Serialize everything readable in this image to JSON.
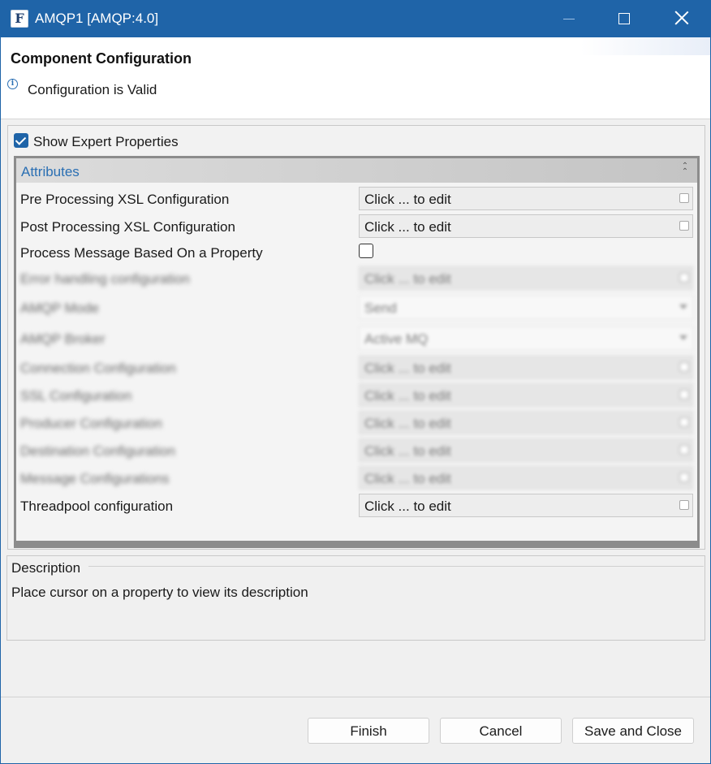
{
  "window": {
    "title": "AMQP1 [AMQP:4.0]",
    "icon_letter": "F",
    "controls": [
      "minimize-icon",
      "maximize-icon",
      "close-icon"
    ]
  },
  "header": {
    "title": "Component Configuration",
    "status_message": "Configuration is Valid",
    "status_icon": "info-icon"
  },
  "options": {
    "show_expert_label": "Show Expert Properties",
    "show_expert_checked": true
  },
  "attributes": {
    "section_title": "Attributes",
    "properties": [
      {
        "label": "Pre Processing XSL Configuration",
        "value": "Click ... to edit",
        "kind": "dialog"
      },
      {
        "label": "Post Processing XSL Configuration",
        "value": "Click ... to edit",
        "kind": "dialog"
      },
      {
        "label": "Process Message Based On a Property",
        "value": "",
        "kind": "checkbox",
        "checked": false
      },
      {
        "label": "Error handling configuration",
        "value": "Click ... to edit",
        "kind": "dialog",
        "blurred": true
      },
      {
        "label": "AMQP Mode",
        "value": "Send",
        "kind": "combo",
        "blurred": true
      },
      {
        "label": "AMQP Broker",
        "value": "Active MQ",
        "kind": "combo",
        "blurred": true
      },
      {
        "label": "Connection Configuration",
        "value": "Click ... to edit",
        "kind": "dialog",
        "blurred": true
      },
      {
        "label": "SSL Configuration",
        "value": "Click ... to edit",
        "kind": "dialog",
        "blurred": true
      },
      {
        "label": "Producer Configuration",
        "value": "Click ... to edit",
        "kind": "dialog",
        "blurred": true
      },
      {
        "label": "Destination Configuration",
        "value": "Click ... to edit",
        "kind": "dialog",
        "blurred": true
      },
      {
        "label": "Message Configurations",
        "value": "Click ... to edit",
        "kind": "dialog",
        "blurred": true
      },
      {
        "label": "Threadpool configuration",
        "value": "Click ... to edit",
        "kind": "dialog"
      }
    ]
  },
  "description": {
    "title": "Description",
    "text": "Place cursor on a property to view its description"
  },
  "footer": {
    "finish_label": "Finish",
    "cancel_label": "Cancel",
    "save_close_label": "Save and Close"
  },
  "colors": {
    "titlebar": "#1f64a8",
    "accent_text": "#2a6fb3",
    "checkbox_checked": "#1f64a8"
  }
}
